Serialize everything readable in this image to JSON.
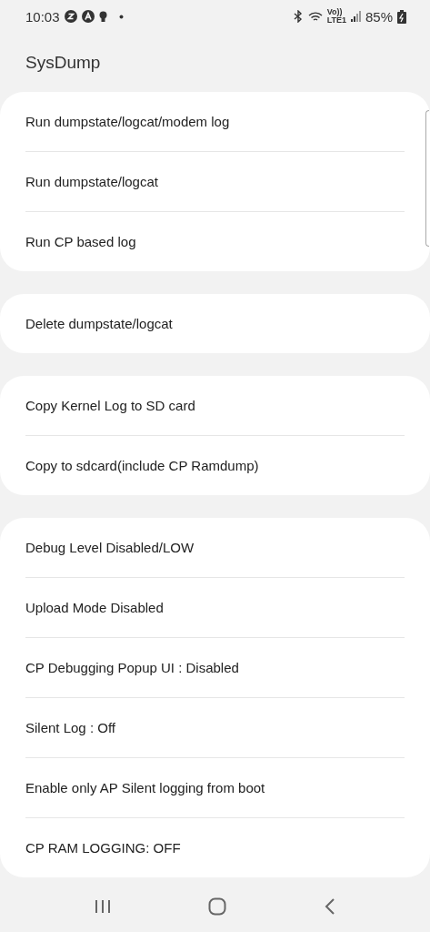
{
  "status_bar": {
    "time": "10:03",
    "volte": "Vo))",
    "lte": "LTE1",
    "battery": "85%"
  },
  "title": "SysDump",
  "groups": [
    {
      "items": [
        "Run dumpstate/logcat/modem log",
        "Run dumpstate/logcat",
        "Run CP based log"
      ]
    },
    {
      "items": [
        "Delete dumpstate/logcat"
      ]
    },
    {
      "items": [
        "Copy Kernel Log to SD card",
        "Copy to sdcard(include CP Ramdump)"
      ]
    },
    {
      "items": [
        "Debug Level Disabled/LOW",
        "Upload Mode Disabled",
        "CP Debugging Popup UI : Disabled",
        "Silent Log : Off",
        "Enable only AP Silent logging from boot",
        "CP RAM LOGGING: OFF"
      ]
    }
  ]
}
